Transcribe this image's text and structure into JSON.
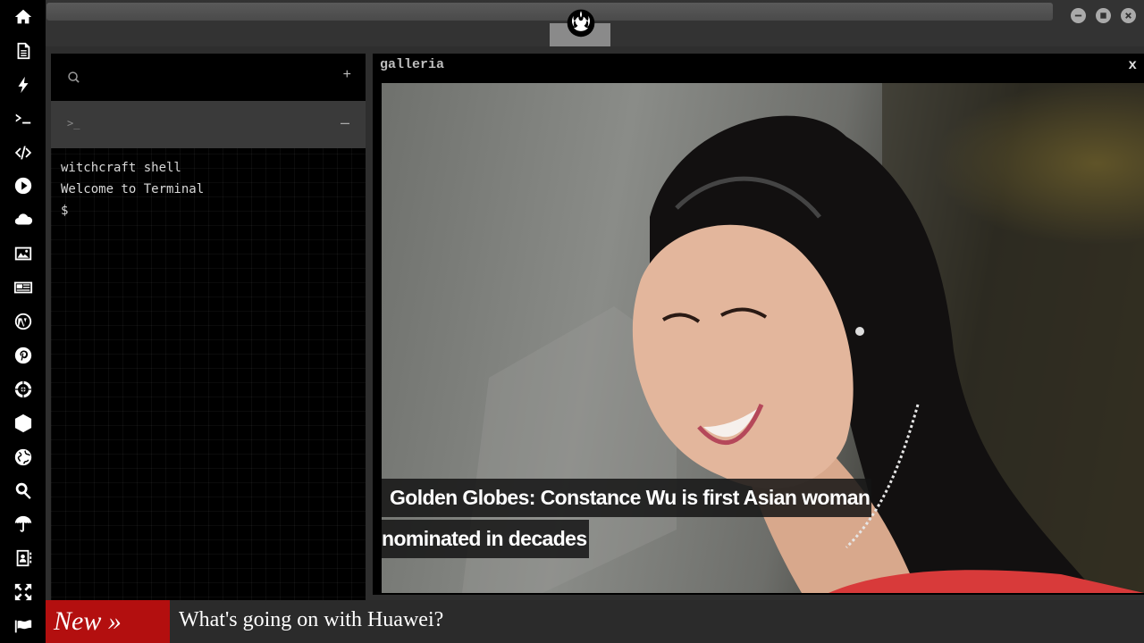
{
  "sidebar": {
    "icons": [
      "home-icon",
      "document-icon",
      "bolt-icon",
      "terminal-icon",
      "code-icon",
      "play-icon",
      "cloud-icon",
      "image-icon",
      "newspaper-icon",
      "wordpress-icon",
      "pinterest-icon",
      "rebel-alliance-icon",
      "atom-icon",
      "globe-icon",
      "search-icon",
      "umbrella-icon",
      "contacts-icon",
      "expand-icon",
      "flag-icon"
    ]
  },
  "topbar": {
    "logo": "rebel-alliance-icon",
    "window_buttons": [
      "minimize-icon",
      "maximize-icon",
      "close-icon"
    ]
  },
  "terminal": {
    "add_label": "+",
    "tab_prompt": ">_",
    "minus_label": "–",
    "lines": [
      "witchcraft shell",
      "Welcome to Terminal",
      "$"
    ]
  },
  "gallery": {
    "title": "galleria",
    "close_label": "x",
    "caption_line1": "Golden Globes: Constance Wu is first Asian woman",
    "caption_line2": "nominated in decades"
  },
  "ticker": {
    "badge": "New »",
    "headline": "What's going on with Huawei?"
  },
  "colors": {
    "ticker_badge": "#b30f0f",
    "sidebar_bg": "#000000",
    "chrome_bg": "#2e2e2e"
  }
}
